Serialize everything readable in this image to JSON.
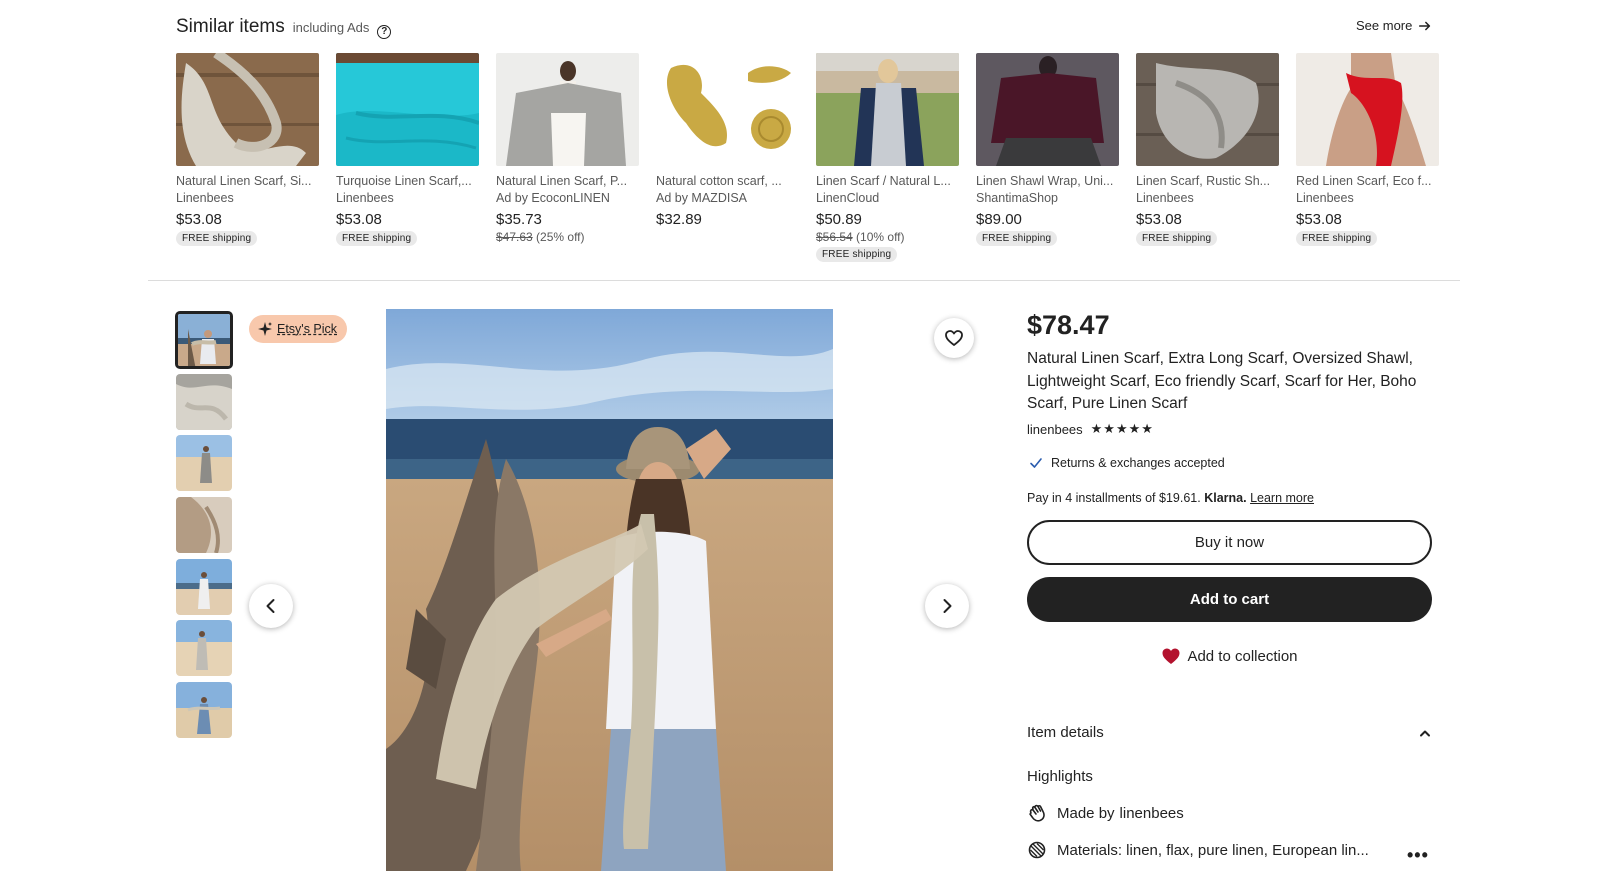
{
  "similar": {
    "title": "Similar items",
    "subtitle": "including Ads",
    "help_icon": "question-circle-icon",
    "see_more": "See more",
    "items": [
      {
        "title": "Natural Linen Scarf, Si...",
        "shop": "Linenbees",
        "price": "$53.08",
        "original_price": "",
        "discount": "",
        "badge": "FREE shipping"
      },
      {
        "title": "Turquoise Linen Scarf,...",
        "shop": "Linenbees",
        "price": "$53.08",
        "original_price": "",
        "discount": "",
        "badge": "FREE shipping"
      },
      {
        "title": "Natural Linen Scarf, P...",
        "shop": "Ad by EcoconLINEN",
        "price": "$35.73",
        "original_price": "$47.63",
        "discount": "(25% off)",
        "badge": ""
      },
      {
        "title": "Natural cotton scarf, ...",
        "shop": "Ad by MAZDISA",
        "price": "$32.89",
        "original_price": "",
        "discount": "",
        "badge": ""
      },
      {
        "title": "Linen Scarf / Natural L...",
        "shop": "LinenCloud",
        "price": "$50.89",
        "original_price": "$56.54",
        "discount": "(10% off)",
        "badge": "FREE shipping"
      },
      {
        "title": "Linen Shawl Wrap, Uni...",
        "shop": "ShantimaShop",
        "price": "$89.00",
        "original_price": "",
        "discount": "",
        "badge": "FREE shipping"
      },
      {
        "title": "Linen Scarf, Rustic Sh...",
        "shop": "Linenbees",
        "price": "$53.08",
        "original_price": "",
        "discount": "",
        "badge": "FREE shipping"
      },
      {
        "title": "Red Linen Scarf, Eco f...",
        "shop": "Linenbees",
        "price": "$53.08",
        "original_price": "",
        "discount": "",
        "badge": "FREE shipping"
      }
    ]
  },
  "gallery": {
    "badge": "Etsy's Pick",
    "thumbnail_count": 7,
    "active_thumbnail": 1
  },
  "listing": {
    "price": "$78.47",
    "title": "Natural Linen Scarf, Extra Long Scarf, Oversized Shawl, Lightweight Scarf, Eco friendly Scarf, Scarf for Her, Boho Scarf, Pure Linen Scarf",
    "shop": "linenbees",
    "rating": 5,
    "stars": "★★★★★",
    "returns": "Returns & exchanges accepted",
    "klarna_text": "Pay in 4 installments of $19.61.",
    "klarna_brand": "Klarna.",
    "klarna_link": "Learn more",
    "buy_now": "Buy it now",
    "add_to_cart": "Add to cart",
    "add_to_collection": "Add to collection",
    "item_details": "Item details",
    "highlights": "Highlights",
    "made_by_prefix": "Made by",
    "made_by_shop": "linenbees",
    "materials": "Materials: linen, flax, pure linen, European lin..."
  },
  "colors": {
    "accent_dark": "#222222",
    "badge_bg": "#f8c8ac",
    "heart_red": "#b3122e",
    "check_blue": "#2a5cae",
    "free_ship_bg": "#e9e9e9"
  }
}
